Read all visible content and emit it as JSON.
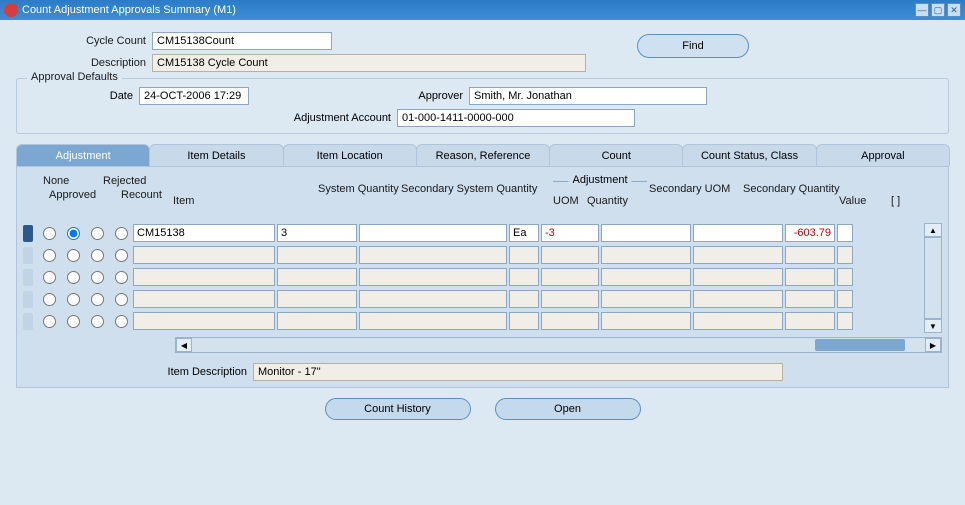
{
  "window": {
    "title": "Count Adjustment Approvals Summary (M1)"
  },
  "header": {
    "cycle_count_label": "Cycle Count",
    "cycle_count_value": "CM15138Count",
    "description_label": "Description",
    "description_value": "CM15138 Cycle Count",
    "find_label": "Find"
  },
  "defaults": {
    "legend": "Approval Defaults",
    "date_label": "Date",
    "date_value": "24-OCT-2006 17:29",
    "approver_label": "Approver",
    "approver_value": "Smith, Mr. Jonathan",
    "adj_account_label": "Adjustment Account",
    "adj_account_value": "01-000-1411-0000-000"
  },
  "tabs": {
    "adjustment": "Adjustment",
    "item_details": "Item Details",
    "item_location": "Item Location",
    "reason_ref": "Reason, Reference",
    "count": "Count",
    "count_status": "Count Status, Class",
    "approval": "Approval"
  },
  "grid": {
    "hdr_none": "None",
    "hdr_approved": "Approved",
    "hdr_rejected": "Rejected",
    "hdr_recount": "Recount",
    "hdr_item": "Item",
    "hdr_sysqty": "System Quantity",
    "hdr_secsysqty": "Secondary System Quantity",
    "hdr_adjustment": "Adjustment",
    "hdr_uom": "UOM",
    "hdr_quantity": "Quantity",
    "hdr_secuom": "Secondary UOM",
    "hdr_secqty": "Secondary Quantity",
    "hdr_value": "Value",
    "hdr_check": "[ ]",
    "rows": [
      {
        "item": "CM15138",
        "sysqty": "3",
        "secsys": "",
        "uom": "Ea",
        "adjqty": "-3",
        "secuom": "",
        "secqty": "",
        "value": "-603.79"
      }
    ]
  },
  "item_desc": {
    "label": "Item Description",
    "value": "Monitor - 17\""
  },
  "buttons": {
    "count_history": "Count History",
    "open": "Open"
  }
}
